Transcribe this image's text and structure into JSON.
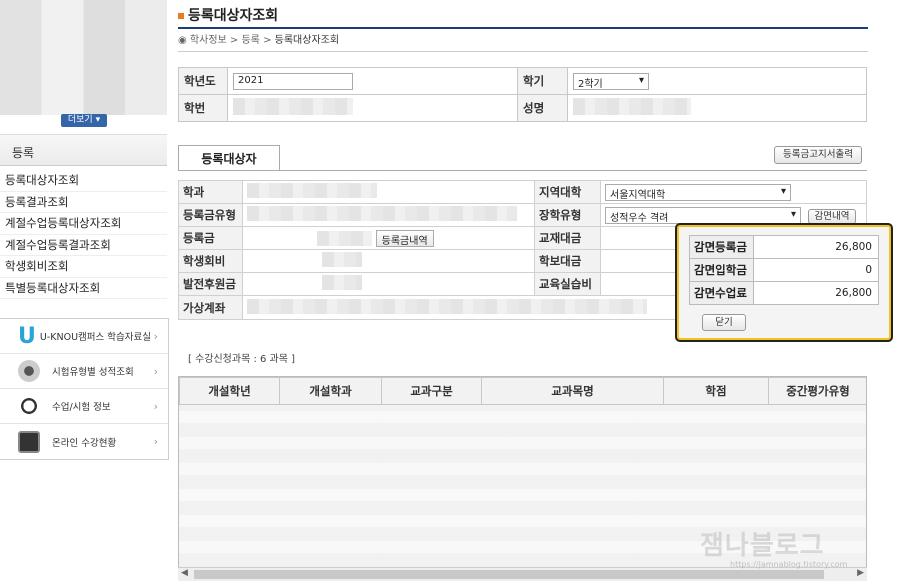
{
  "sidebar": {
    "more_label": "더보기",
    "section_title": "등록",
    "menu": [
      "등록대상자조회",
      "등록결과조회",
      "계절수업등록대상자조회",
      "계절수업등록결과조회",
      "학생회비조회",
      "특별등록대상자조회"
    ],
    "quick": [
      {
        "label": "U-KNOU캠퍼스 학습자료실",
        "icon": "u-knou-logo-icon"
      },
      {
        "label": "시험유형별 성적조회",
        "icon": "pen-icon"
      },
      {
        "label": "수업/시험 정보",
        "icon": "headset-icon"
      },
      {
        "label": "온라인 수강현황",
        "icon": "monitor-icon"
      }
    ]
  },
  "page": {
    "title": "등록대상자조회",
    "breadcrumb": [
      "학사정보",
      "등록",
      "등록대상자조회"
    ]
  },
  "info": {
    "year_label": "학년도",
    "year_value": "2021",
    "term_label": "학기",
    "term_value": "2학기",
    "id_label": "학번",
    "name_label": "성명"
  },
  "tab_label": "등록대상자",
  "print_button": "등록금고지서출력",
  "detail": {
    "dept_label": "학과",
    "fee_type_label": "등록금유형",
    "tuition_label": "등록금",
    "tuition_btn": "등록금내역",
    "council_label": "학생회비",
    "dev_fund_label": "발전후원금",
    "account_label": "가상계좌",
    "region_label": "지역대학",
    "region_value": "서울지역대학",
    "scholarship_label": "장학유형",
    "scholarship_value": "성적우수 격려",
    "reduction_btn": "감면내역",
    "textbook_label": "교재대금",
    "paper_label": "학보대금",
    "practice_label": "교육실습비"
  },
  "popup": {
    "rows": [
      {
        "label": "감면등록금",
        "value": "26,800"
      },
      {
        "label": "감면입학금",
        "value": "0"
      },
      {
        "label": "감면수업료",
        "value": "26,800"
      }
    ],
    "close_label": "닫기"
  },
  "courses": {
    "count_text": "[ 수강신청과목 : 6 과목 ]",
    "headers": [
      "개설학년",
      "개설학과",
      "교과구분",
      "교과목명",
      "학점",
      "중간평가유형"
    ]
  },
  "watermark": "잼나블로그",
  "watermark_sub": "https://jamnablog.tistory.com",
  "colors": {
    "highlight": "#f2c21b",
    "title_bar": "#1e3d78",
    "more_button": "#3465a8"
  }
}
